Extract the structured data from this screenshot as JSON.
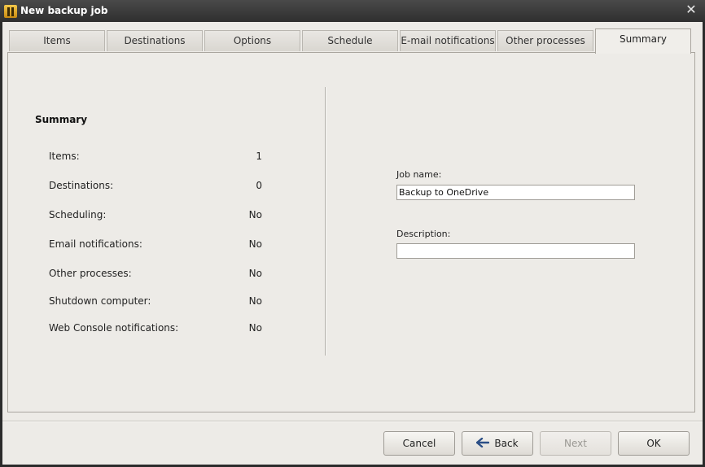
{
  "window": {
    "title": "New backup job"
  },
  "tabs": [
    {
      "label": "Items"
    },
    {
      "label": "Destinations"
    },
    {
      "label": "Options"
    },
    {
      "label": "Schedule"
    },
    {
      "label": "E-mail notifications"
    },
    {
      "label": "Other processes"
    },
    {
      "label": "Summary",
      "active": true
    }
  ],
  "summary": {
    "heading": "Summary",
    "rows": [
      {
        "label": "Items:",
        "value": "1"
      },
      {
        "label": "Destinations:",
        "value": "0"
      },
      {
        "label": "Scheduling:",
        "value": "No"
      },
      {
        "label": "Email notifications:",
        "value": "No"
      },
      {
        "label": "Other processes:",
        "value": "No"
      },
      {
        "label": "Shutdown computer:",
        "value": "No"
      },
      {
        "label": "Web Console notifications:",
        "value": "No"
      }
    ]
  },
  "form": {
    "job_name_label": "Job name:",
    "job_name_value": "Backup to OneDrive",
    "description_label": "Description:",
    "description_value": ""
  },
  "buttons": {
    "cancel": "Cancel",
    "back": "Back",
    "next": "Next",
    "ok": "OK"
  },
  "icons": {
    "app": "app-icon",
    "close": "close-icon",
    "back": "back-arrow-icon"
  }
}
